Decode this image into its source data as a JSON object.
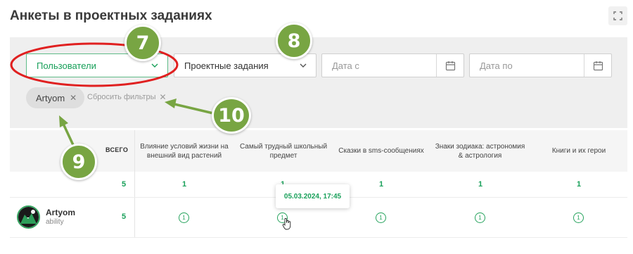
{
  "page": {
    "title": "Анкеты в проектных заданиях"
  },
  "filters": {
    "users_select": "Пользователи",
    "tasks_select": "Проектные задания",
    "date_from_placeholder": "Дата с",
    "date_to_placeholder": "Дата по",
    "active_chip": "Artyom",
    "reset_label": "Сбросить фильтры"
  },
  "table": {
    "total_header": "ВСЕГО",
    "columns": [
      "Влияние условий жизни на внешний вид растений",
      "Самый трудный школьный предмет",
      "Сказки в sms-сообщениях",
      "Знаки зодиака: астрономия & астрология",
      "Книги и их герои"
    ],
    "summary": {
      "total": "5",
      "counts": [
        "1",
        "1",
        "1",
        "1",
        "1"
      ]
    },
    "rows": [
      {
        "name": "Artyom",
        "role": "ability",
        "total": "5",
        "badges": [
          "1",
          "1",
          "1",
          "1",
          "1"
        ]
      }
    ]
  },
  "tooltip": {
    "text": "05.03.2024, 17:45"
  },
  "annotations": {
    "markers": [
      "7",
      "8",
      "9",
      "10"
    ]
  },
  "colors": {
    "accent": "#19a05a",
    "marker": "#78a543",
    "highlight_ring": "#e02020",
    "arrow": "#78a543"
  }
}
